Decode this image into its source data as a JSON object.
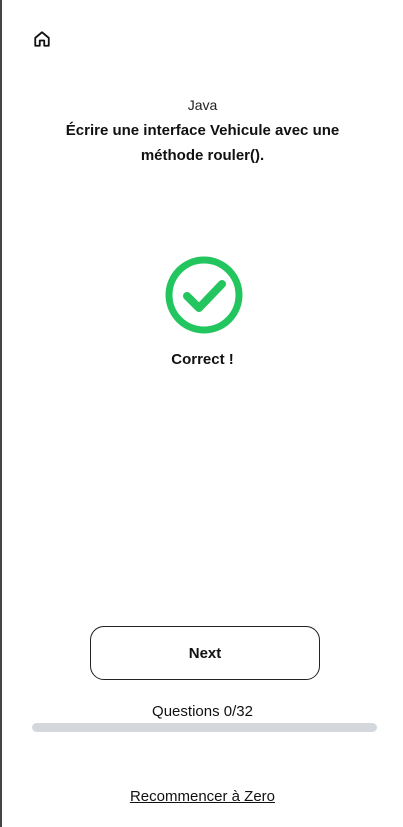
{
  "header": {
    "home_icon": "home-icon"
  },
  "quiz": {
    "subject": "Java",
    "question": "Écrire une interface Vehicule avec une méthode rouler().",
    "result_icon": "check-circle-icon",
    "result_color": "#22c55e",
    "result_text": "Correct !"
  },
  "actions": {
    "next_label": "Next",
    "restart_label": "Recommencer à Zero"
  },
  "progress": {
    "label": "Questions 0/32",
    "current": 0,
    "total": 32,
    "fraction": 0
  }
}
